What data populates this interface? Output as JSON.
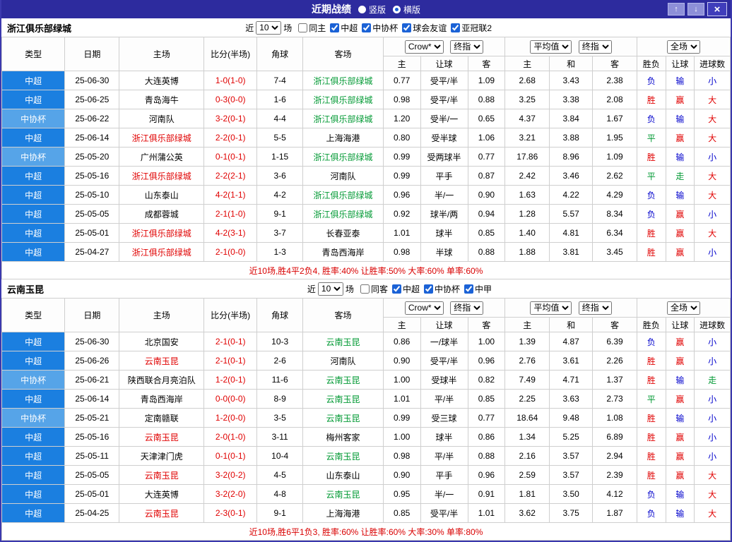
{
  "titlebar": {
    "title": "近期战绩",
    "view_options": [
      {
        "label": "竖版",
        "selected": false
      },
      {
        "label": "横版",
        "selected": true
      }
    ],
    "up_icon": "↑",
    "down_icon": "↓",
    "close_icon": "×"
  },
  "table_headers": {
    "type": "类型",
    "date": "日期",
    "home": "主场",
    "score": "比分(半场)",
    "corner": "角球",
    "away": "客场",
    "ah_home": "主",
    "ah_line": "让球",
    "ah_away": "客",
    "eu_home": "主",
    "eu_draw": "和",
    "eu_away": "客",
    "res_wdl": "胜负",
    "res_handicap": "让球",
    "res_goals": "进球数"
  },
  "colors": {
    "titlebar_bg": "#2d2b9e",
    "csl_bg": "#1b7fe0",
    "cup_bg": "#56a4e8",
    "win_red": "#e00000",
    "loss_blue": "#0000cc",
    "draw_green": "#009933"
  },
  "sections": [
    {
      "team": "浙江俱乐部绿城",
      "filter": {
        "near_label": "近",
        "count": "10",
        "games_label": "场",
        "checkboxes": [
          {
            "label": "同主",
            "checked": false
          },
          {
            "label": "中超",
            "checked": true
          },
          {
            "label": "中协杯",
            "checked": true
          },
          {
            "label": "球会友谊",
            "checked": true
          },
          {
            "label": "亚冠联2",
            "checked": true
          }
        ]
      },
      "selects": {
        "book": "Crow*",
        "book_time": "终指",
        "eu_source": "平均值",
        "eu_time": "终指",
        "scope": "全场"
      },
      "rows": [
        {
          "type": "中超",
          "type_cls": "csl",
          "date": "25-06-30",
          "home": "大连英博",
          "home_cls": "",
          "score": "1-0(1-0)",
          "corner": "7-4",
          "away": "浙江俱乐部绿城",
          "away_cls": "green",
          "ah": [
            "0.77",
            "受平/半",
            "1.09"
          ],
          "eu": [
            "2.68",
            "3.43",
            "2.38"
          ],
          "res": [
            {
              "t": "负",
              "c": "blue"
            },
            {
              "t": "输",
              "c": "blue"
            },
            {
              "t": "小",
              "c": "blue"
            }
          ]
        },
        {
          "type": "中超",
          "type_cls": "csl",
          "date": "25-06-25",
          "home": "青岛海牛",
          "home_cls": "",
          "score": "0-3(0-0)",
          "corner": "1-6",
          "away": "浙江俱乐部绿城",
          "away_cls": "green",
          "ah": [
            "0.98",
            "受平/半",
            "0.88"
          ],
          "eu": [
            "3.25",
            "3.38",
            "2.08"
          ],
          "res": [
            {
              "t": "胜",
              "c": "red"
            },
            {
              "t": "赢",
              "c": "red"
            },
            {
              "t": "大",
              "c": "red"
            }
          ]
        },
        {
          "type": "中协杯",
          "type_cls": "cup",
          "date": "25-06-22",
          "home": "河南队",
          "home_cls": "",
          "score": "3-2(0-1)",
          "corner": "4-4",
          "away": "浙江俱乐部绿城",
          "away_cls": "green",
          "ah": [
            "1.20",
            "受半/一",
            "0.65"
          ],
          "eu": [
            "4.37",
            "3.84",
            "1.67"
          ],
          "res": [
            {
              "t": "负",
              "c": "blue"
            },
            {
              "t": "输",
              "c": "blue"
            },
            {
              "t": "大",
              "c": "red"
            }
          ]
        },
        {
          "type": "中超",
          "type_cls": "csl",
          "date": "25-06-14",
          "home": "浙江俱乐部绿城",
          "home_cls": "red",
          "score": "2-2(0-1)",
          "corner": "5-5",
          "away": "上海海港",
          "away_cls": "",
          "ah": [
            "0.80",
            "受半球",
            "1.06"
          ],
          "eu": [
            "3.21",
            "3.88",
            "1.95"
          ],
          "res": [
            {
              "t": "平",
              "c": "green"
            },
            {
              "t": "赢",
              "c": "red"
            },
            {
              "t": "大",
              "c": "red"
            }
          ]
        },
        {
          "type": "中协杯",
          "type_cls": "cup",
          "date": "25-05-20",
          "home": "广州蒲公英",
          "home_cls": "",
          "score": "0-1(0-1)",
          "corner": "1-15",
          "away": "浙江俱乐部绿城",
          "away_cls": "green",
          "ah": [
            "0.99",
            "受两球半",
            "0.77"
          ],
          "eu": [
            "17.86",
            "8.96",
            "1.09"
          ],
          "res": [
            {
              "t": "胜",
              "c": "red"
            },
            {
              "t": "输",
              "c": "blue"
            },
            {
              "t": "小",
              "c": "blue"
            }
          ]
        },
        {
          "type": "中超",
          "type_cls": "csl",
          "date": "25-05-16",
          "home": "浙江俱乐部绿城",
          "home_cls": "red",
          "score": "2-2(2-1)",
          "corner": "3-6",
          "away": "河南队",
          "away_cls": "",
          "ah": [
            "0.99",
            "平手",
            "0.87"
          ],
          "eu": [
            "2.42",
            "3.46",
            "2.62"
          ],
          "res": [
            {
              "t": "平",
              "c": "green"
            },
            {
              "t": "走",
              "c": "green"
            },
            {
              "t": "大",
              "c": "red"
            }
          ]
        },
        {
          "type": "中超",
          "type_cls": "csl",
          "date": "25-05-10",
          "home": "山东泰山",
          "home_cls": "",
          "score": "4-2(1-1)",
          "corner": "4-2",
          "away": "浙江俱乐部绿城",
          "away_cls": "green",
          "ah": [
            "0.96",
            "半/一",
            "0.90"
          ],
          "eu": [
            "1.63",
            "4.22",
            "4.29"
          ],
          "res": [
            {
              "t": "负",
              "c": "blue"
            },
            {
              "t": "输",
              "c": "blue"
            },
            {
              "t": "大",
              "c": "red"
            }
          ]
        },
        {
          "type": "中超",
          "type_cls": "csl",
          "date": "25-05-05",
          "home": "成都蓉城",
          "home_cls": "",
          "score": "2-1(1-0)",
          "corner": "9-1",
          "away": "浙江俱乐部绿城",
          "away_cls": "green",
          "ah": [
            "0.92",
            "球半/两",
            "0.94"
          ],
          "eu": [
            "1.28",
            "5.57",
            "8.34"
          ],
          "res": [
            {
              "t": "负",
              "c": "blue"
            },
            {
              "t": "赢",
              "c": "red"
            },
            {
              "t": "小",
              "c": "blue"
            }
          ]
        },
        {
          "type": "中超",
          "type_cls": "csl",
          "date": "25-05-01",
          "home": "浙江俱乐部绿城",
          "home_cls": "red",
          "score": "4-2(3-1)",
          "corner": "3-7",
          "away": "长春亚泰",
          "away_cls": "",
          "ah": [
            "1.01",
            "球半",
            "0.85"
          ],
          "eu": [
            "1.40",
            "4.81",
            "6.34"
          ],
          "res": [
            {
              "t": "胜",
              "c": "red"
            },
            {
              "t": "赢",
              "c": "red"
            },
            {
              "t": "大",
              "c": "red"
            }
          ]
        },
        {
          "type": "中超",
          "type_cls": "csl",
          "date": "25-04-27",
          "home": "浙江俱乐部绿城",
          "home_cls": "red",
          "score": "2-1(0-0)",
          "corner": "1-3",
          "away": "青岛西海岸",
          "away_cls": "",
          "ah": [
            "0.98",
            "半球",
            "0.88"
          ],
          "eu": [
            "1.88",
            "3.81",
            "3.45"
          ],
          "res": [
            {
              "t": "胜",
              "c": "red"
            },
            {
              "t": "赢",
              "c": "red"
            },
            {
              "t": "小",
              "c": "blue"
            }
          ]
        }
      ],
      "summary": "近10场,胜4平2负4, 胜率:40% 让胜率:50% 大率:60% 单率:60%"
    },
    {
      "team": "云南玉昆",
      "filter": {
        "near_label": "近",
        "count": "10",
        "games_label": "场",
        "checkboxes": [
          {
            "label": "同客",
            "checked": false
          },
          {
            "label": "中超",
            "checked": true
          },
          {
            "label": "中协杯",
            "checked": true
          },
          {
            "label": "中甲",
            "checked": true
          }
        ]
      },
      "selects": {
        "book": "Crow*",
        "book_time": "终指",
        "eu_source": "平均值",
        "eu_time": "终指",
        "scope": "全场"
      },
      "rows": [
        {
          "type": "中超",
          "type_cls": "csl",
          "date": "25-06-30",
          "home": "北京国安",
          "home_cls": "",
          "score": "2-1(0-1)",
          "corner": "10-3",
          "away": "云南玉昆",
          "away_cls": "green",
          "ah": [
            "0.86",
            "一/球半",
            "1.00"
          ],
          "eu": [
            "1.39",
            "4.87",
            "6.39"
          ],
          "res": [
            {
              "t": "负",
              "c": "blue"
            },
            {
              "t": "赢",
              "c": "red"
            },
            {
              "t": "小",
              "c": "blue"
            }
          ]
        },
        {
          "type": "中超",
          "type_cls": "csl",
          "date": "25-06-26",
          "home": "云南玉昆",
          "home_cls": "red",
          "score": "2-1(0-1)",
          "corner": "2-6",
          "away": "河南队",
          "away_cls": "",
          "ah": [
            "0.90",
            "受平/半",
            "0.96"
          ],
          "eu": [
            "2.76",
            "3.61",
            "2.26"
          ],
          "res": [
            {
              "t": "胜",
              "c": "red"
            },
            {
              "t": "赢",
              "c": "red"
            },
            {
              "t": "小",
              "c": "blue"
            }
          ]
        },
        {
          "type": "中协杯",
          "type_cls": "cup",
          "date": "25-06-21",
          "home": "陕西联合月亮泊队",
          "home_cls": "",
          "score": "1-2(0-1)",
          "corner": "11-6",
          "away": "云南玉昆",
          "away_cls": "green",
          "ah": [
            "1.00",
            "受球半",
            "0.82"
          ],
          "eu": [
            "7.49",
            "4.71",
            "1.37"
          ],
          "res": [
            {
              "t": "胜",
              "c": "red"
            },
            {
              "t": "输",
              "c": "blue"
            },
            {
              "t": "走",
              "c": "green"
            }
          ]
        },
        {
          "type": "中超",
          "type_cls": "csl",
          "date": "25-06-14",
          "home": "青岛西海岸",
          "home_cls": "",
          "score": "0-0(0-0)",
          "corner": "8-9",
          "away": "云南玉昆",
          "away_cls": "green",
          "ah": [
            "1.01",
            "平/半",
            "0.85"
          ],
          "eu": [
            "2.25",
            "3.63",
            "2.73"
          ],
          "res": [
            {
              "t": "平",
              "c": "green"
            },
            {
              "t": "赢",
              "c": "red"
            },
            {
              "t": "小",
              "c": "blue"
            }
          ]
        },
        {
          "type": "中协杯",
          "type_cls": "cup",
          "date": "25-05-21",
          "home": "定南赣联",
          "home_cls": "",
          "score": "1-2(0-0)",
          "corner": "3-5",
          "away": "云南玉昆",
          "away_cls": "green",
          "ah": [
            "0.99",
            "受三球",
            "0.77"
          ],
          "eu": [
            "18.64",
            "9.48",
            "1.08"
          ],
          "res": [
            {
              "t": "胜",
              "c": "red"
            },
            {
              "t": "输",
              "c": "blue"
            },
            {
              "t": "小",
              "c": "blue"
            }
          ]
        },
        {
          "type": "中超",
          "type_cls": "csl",
          "date": "25-05-16",
          "home": "云南玉昆",
          "home_cls": "red",
          "score": "2-0(1-0)",
          "corner": "3-11",
          "away": "梅州客家",
          "away_cls": "",
          "ah": [
            "1.00",
            "球半",
            "0.86"
          ],
          "eu": [
            "1.34",
            "5.25",
            "6.89"
          ],
          "res": [
            {
              "t": "胜",
              "c": "red"
            },
            {
              "t": "赢",
              "c": "red"
            },
            {
              "t": "小",
              "c": "blue"
            }
          ]
        },
        {
          "type": "中超",
          "type_cls": "csl",
          "date": "25-05-11",
          "home": "天津津门虎",
          "home_cls": "",
          "score": "0-1(0-1)",
          "corner": "10-4",
          "away": "云南玉昆",
          "away_cls": "green",
          "ah": [
            "0.98",
            "平/半",
            "0.88"
          ],
          "eu": [
            "2.16",
            "3.57",
            "2.94"
          ],
          "res": [
            {
              "t": "胜",
              "c": "red"
            },
            {
              "t": "赢",
              "c": "red"
            },
            {
              "t": "小",
              "c": "blue"
            }
          ]
        },
        {
          "type": "中超",
          "type_cls": "csl",
          "date": "25-05-05",
          "home": "云南玉昆",
          "home_cls": "red",
          "score": "3-2(0-2)",
          "corner": "4-5",
          "away": "山东泰山",
          "away_cls": "",
          "ah": [
            "0.90",
            "平手",
            "0.96"
          ],
          "eu": [
            "2.59",
            "3.57",
            "2.39"
          ],
          "res": [
            {
              "t": "胜",
              "c": "red"
            },
            {
              "t": "赢",
              "c": "red"
            },
            {
              "t": "大",
              "c": "red"
            }
          ]
        },
        {
          "type": "中超",
          "type_cls": "csl",
          "date": "25-05-01",
          "home": "大连英博",
          "home_cls": "",
          "score": "3-2(2-0)",
          "corner": "4-8",
          "away": "云南玉昆",
          "away_cls": "green",
          "ah": [
            "0.95",
            "半/一",
            "0.91"
          ],
          "eu": [
            "1.81",
            "3.50",
            "4.12"
          ],
          "res": [
            {
              "t": "负",
              "c": "blue"
            },
            {
              "t": "输",
              "c": "blue"
            },
            {
              "t": "大",
              "c": "red"
            }
          ]
        },
        {
          "type": "中超",
          "type_cls": "csl",
          "date": "25-04-25",
          "home": "云南玉昆",
          "home_cls": "red",
          "score": "2-3(0-1)",
          "corner": "9-1",
          "away": "上海海港",
          "away_cls": "",
          "ah": [
            "0.85",
            "受平/半",
            "1.01"
          ],
          "eu": [
            "3.62",
            "3.75",
            "1.87"
          ],
          "res": [
            {
              "t": "负",
              "c": "blue"
            },
            {
              "t": "输",
              "c": "blue"
            },
            {
              "t": "大",
              "c": "red"
            }
          ]
        }
      ],
      "summary": "近10场,胜6平1负3, 胜率:60% 让胜率:60% 大率:30% 单率:80%"
    }
  ]
}
